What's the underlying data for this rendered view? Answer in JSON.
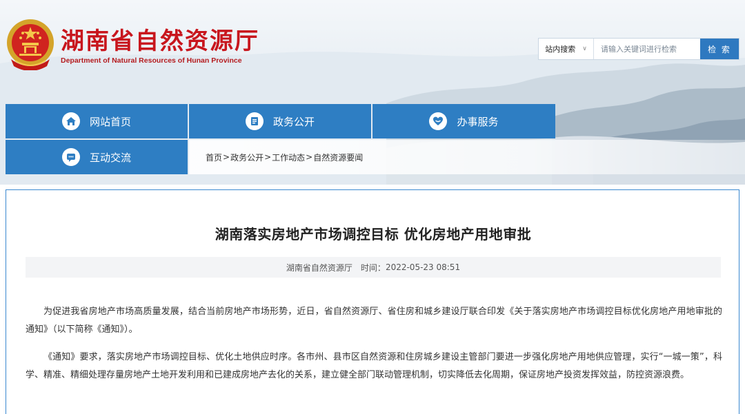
{
  "site": {
    "title": "湖南省自然资源厅",
    "subtitle": "Department of Natural Resources of Hunan Province"
  },
  "search": {
    "scope_label": "站内搜索",
    "placeholder": "请输入关键词进行检索",
    "button_label": "检 索"
  },
  "nav": {
    "items": [
      {
        "label": "网站首页",
        "icon": "home-icon"
      },
      {
        "label": "政务公开",
        "icon": "document-icon"
      },
      {
        "label": "办事服务",
        "icon": "service-heart-icon"
      },
      {
        "label": "互动交流",
        "icon": "chat-icon"
      }
    ]
  },
  "breadcrumb": {
    "items": [
      "首页",
      "政务公开",
      "工作动态",
      "自然资源要闻"
    ],
    "separator": ">"
  },
  "article": {
    "title": "湖南落实房地产市场调控目标 优化房地产用地审批",
    "source": "湖南省自然资源厅",
    "time_label": "时间：",
    "time": "2022-05-23 08:51",
    "paragraphs": [
      "为促进我省房地产市场高质量发展，结合当前房地产市场形势，近日，省自然资源厅、省住房和城乡建设厅联合印发《关于落实房地产市场调控目标优化房地产用地审批的通知》（以下简称《通知》）。",
      "《通知》要求，落实房地产市场调控目标、优化土地供应时序。各市州、县市区自然资源和住房城乡建设主管部门要进一步强化房地产用地供应管理，实行“一城一策”，科学、精准、精细处理存量房地产土地开发利用和已建成房地产去化的关系，建立健全部门联动管理机制，切实降低去化周期，保证房地产投资发挥效益，防控资源浪费。"
    ]
  },
  "colors": {
    "brand_red": "#c8161d",
    "nav_blue": "#2e7ec3",
    "border_blue": "#3a88d0",
    "search_button": "#2e79c0"
  }
}
